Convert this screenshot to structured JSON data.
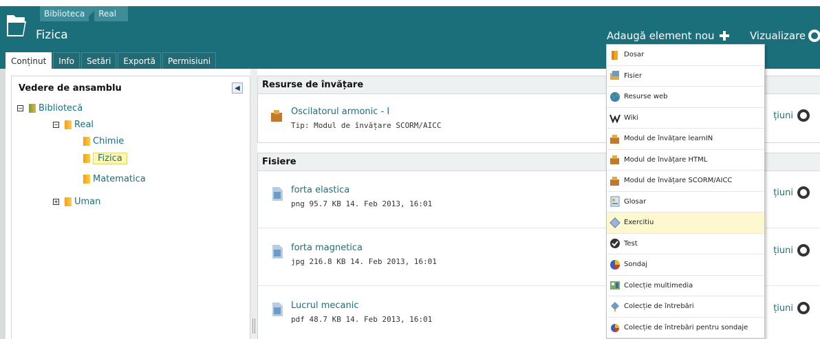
{
  "breadcrumb": [
    "Biblioteca",
    "Real"
  ],
  "title": "Fizica",
  "header_actions": {
    "add": "Adaugă element nou",
    "view": "Vizualizare"
  },
  "tabs": [
    "Conținut",
    "Info",
    "Setări",
    "Exportă",
    "Permisiuni"
  ],
  "overview": {
    "title": "Vedere de ansamblu",
    "tree": [
      {
        "label": "Bibliotecă",
        "toggle": "−"
      },
      {
        "label": "Real",
        "toggle": "−"
      },
      {
        "label": "Chimie"
      },
      {
        "label": "Fizica"
      },
      {
        "label": "Matematica"
      },
      {
        "label": "Uman",
        "toggle": "+"
      }
    ]
  },
  "sections": [
    {
      "title": "Resurse de învățare",
      "items": [
        {
          "title": "Oscilatorul armonic - I",
          "meta": "Tip: Modul de învățare SCORM/AICC"
        }
      ]
    },
    {
      "title": "Fisiere",
      "items": [
        {
          "title": "forta elastica",
          "meta": "png  95.7 KB  14. Feb 2013, 16:01"
        },
        {
          "title": "forta magnetica",
          "meta": "jpg  216.8 KB  14. Feb 2013, 16:01"
        },
        {
          "title": "Lucrul mecanic",
          "meta": "pdf  48.7 KB  14. Feb 2013, 16:01"
        }
      ]
    }
  ],
  "actions_label": "țiuni",
  "add_menu": [
    {
      "label": "Dosar",
      "icon": "folder-icon"
    },
    {
      "label": "Fisier",
      "icon": "file-icon"
    },
    {
      "label": "Resurse web",
      "icon": "globe-icon"
    },
    {
      "label": "Wiki",
      "icon": "wiki-icon"
    },
    {
      "label": "Modul de învățare learnIN",
      "icon": "learning-module-icon"
    },
    {
      "label": "Modul de învățare HTML",
      "icon": "learning-module-icon"
    },
    {
      "label": "Modul de învățare SCORM/AICC",
      "icon": "learning-module-icon"
    },
    {
      "label": "Glosar",
      "icon": "glossary-icon"
    },
    {
      "label": "Exercitiu",
      "icon": "exercise-icon"
    },
    {
      "label": "Test",
      "icon": "test-check-icon"
    },
    {
      "label": "Sondaj",
      "icon": "survey-icon"
    },
    {
      "label": "Colecție multimedia",
      "icon": "media-collection-icon"
    },
    {
      "label": "Colecție de întrebări",
      "icon": "question-pool-icon"
    },
    {
      "label": "Colecție de întrebări pentru sondaje",
      "icon": "survey-pool-icon"
    }
  ],
  "colors": {
    "header": "#1b6f7b",
    "link": "#1b6f7b",
    "highlight": "#fdf8cf"
  }
}
